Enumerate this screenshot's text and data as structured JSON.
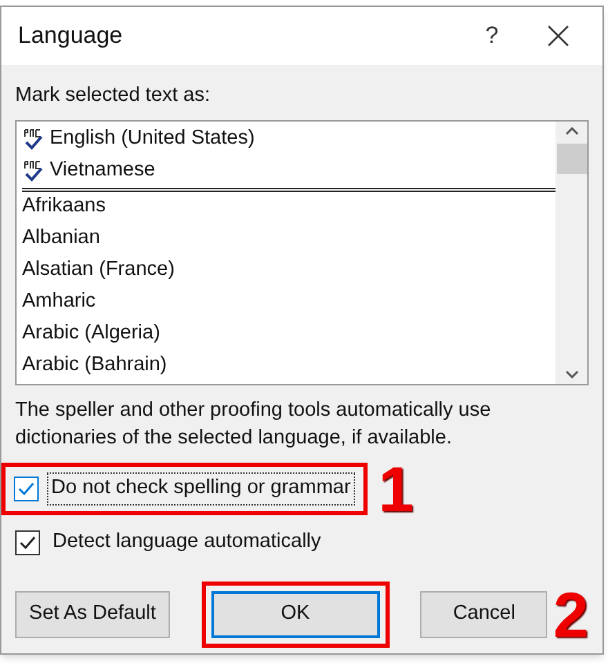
{
  "window": {
    "title": "Language",
    "help": "?"
  },
  "list_label": "Mark selected text as:",
  "languages": [
    {
      "label": "English (United States)",
      "kind": "recent"
    },
    {
      "label": "Vietnamese",
      "kind": "recent"
    },
    {
      "label": "Afrikaans",
      "kind": "language"
    },
    {
      "label": "Albanian",
      "kind": "language"
    },
    {
      "label": "Alsatian (France)",
      "kind": "language"
    },
    {
      "label": "Amharic",
      "kind": "language"
    },
    {
      "label": "Arabic (Algeria)",
      "kind": "language"
    },
    {
      "label": "Arabic (Bahrain)",
      "kind": "language"
    }
  ],
  "note": "The speller and other proofing tools automatically use dictionaries of the selected language, if available.",
  "options": [
    {
      "label": "Do not check spelling or grammar",
      "checked": true,
      "focused": true,
      "highlighted": true,
      "marker": "1"
    },
    {
      "label": "Detect language automatically",
      "checked": true,
      "focused": false,
      "highlighted": false
    }
  ],
  "buttons": [
    {
      "label": "Set As Default",
      "default": false,
      "highlighted": false
    },
    {
      "label": "OK",
      "default": true,
      "highlighted": true
    },
    {
      "label": "Cancel",
      "default": false,
      "highlighted": false,
      "marker": "2"
    }
  ]
}
